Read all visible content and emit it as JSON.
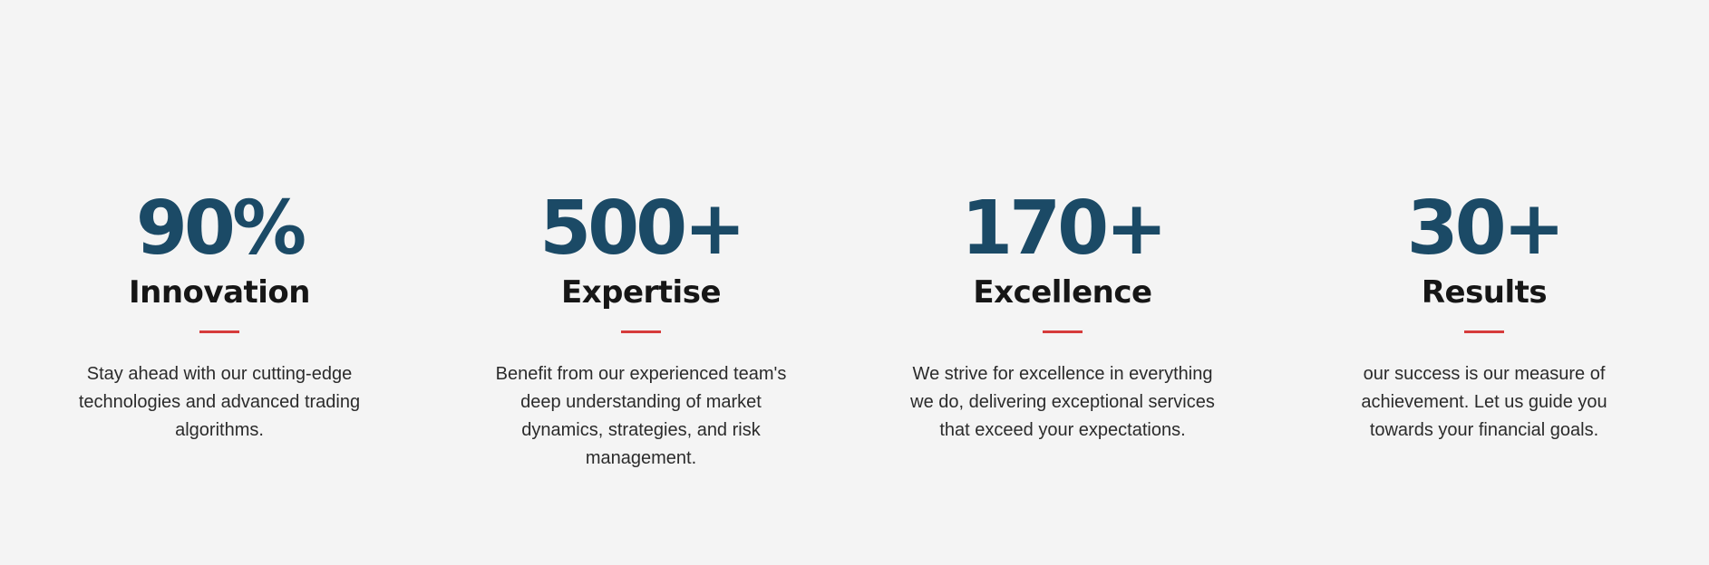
{
  "stats": [
    {
      "number": "90%",
      "title": "Innovation",
      "description": "Stay ahead with our cutting-edge technologies and advanced trading algorithms."
    },
    {
      "number": "500+",
      "title": "Expertise",
      "description": "Benefit from our experienced team's deep understanding of market dynamics, strategies, and risk management."
    },
    {
      "number": "170+",
      "title": "Excellence",
      "description": "We strive for excellence in everything we do, delivering exceptional services that exceed your expectations."
    },
    {
      "number": "30+",
      "title": "Results",
      "description": "our success is our measure of achievement. Let us guide you towards your financial goals."
    }
  ],
  "colors": {
    "background": "#f4f4f4",
    "number": "#1b4a66",
    "title": "#161616",
    "divider": "#d63b3b",
    "text": "#2b2b2b"
  }
}
